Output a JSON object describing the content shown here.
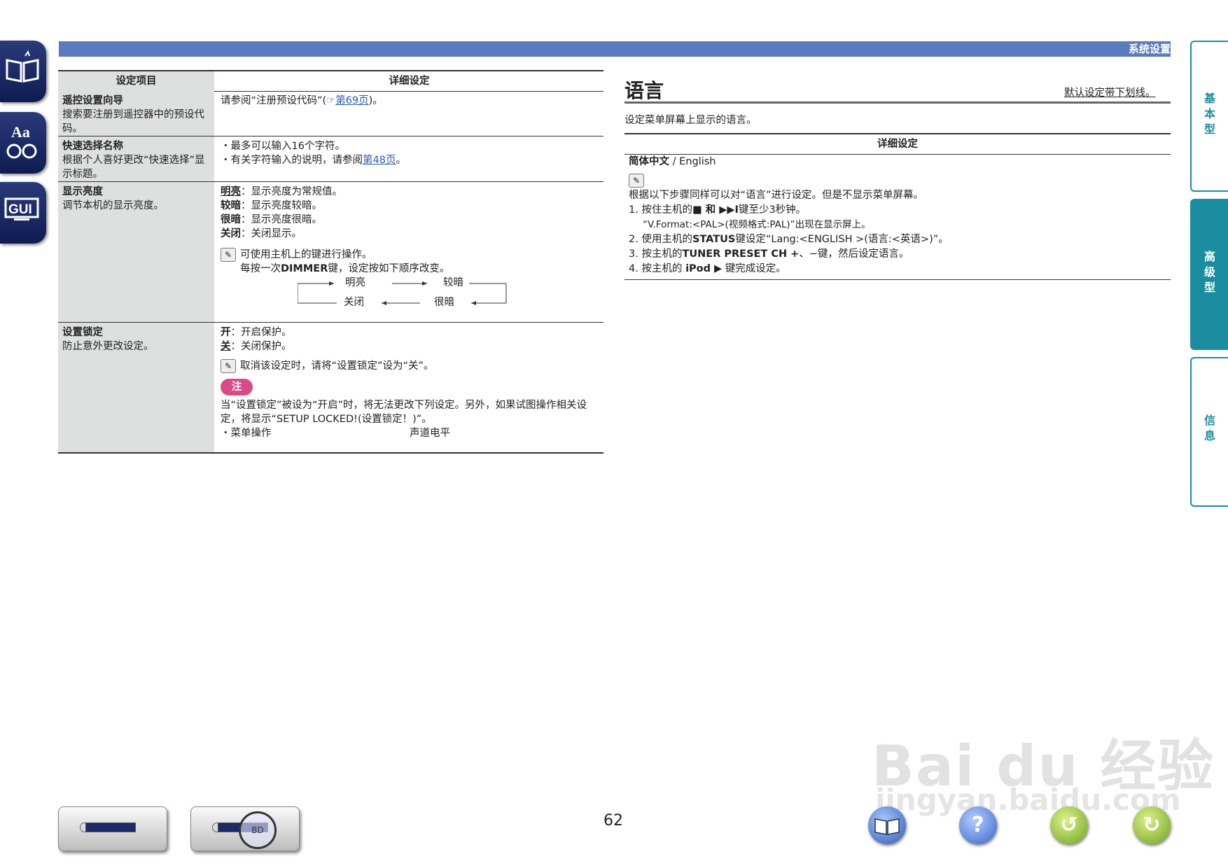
{
  "header": {
    "section_title": "系统设置"
  },
  "side_tabs": [
    {
      "label": "基本型",
      "active": false
    },
    {
      "label": "高级型",
      "active": true
    },
    {
      "label": "信息",
      "active": false
    }
  ],
  "left_icons": [
    "book-icon",
    "font-icon",
    "gui-icon"
  ],
  "left_table": {
    "col1_header": "设定项目",
    "col2_header": "详细设定",
    "rows": [
      {
        "item": "遥控设置向导",
        "desc": "搜索要注册到遥控器中的预设代码。",
        "detail_prefix": "请参阅“注册预设代码”(",
        "detail_link": "第69页",
        "detail_suffix": ")。"
      },
      {
        "item": "快速选择名称",
        "desc": "根据个人喜好更改“快速选择”显示标题。",
        "bullet1": "・最多可以输入16个字符。",
        "bullet2_prefix": "・有关字符输入的说明，请参阅",
        "bullet2_link": "第48页",
        "bullet2_suffix": "。"
      },
      {
        "item": "显示亮度",
        "desc": "调节本机的显示亮度。",
        "opts": [
          {
            "k": "明亮",
            "v": "显示亮度为常规值。"
          },
          {
            "k": "较暗",
            "v": "显示亮度较暗。"
          },
          {
            "k": "很暗",
            "v": "显示亮度很暗。"
          },
          {
            "k": "关闭",
            "v": "关闭显示。"
          }
        ],
        "note1": "可使用主机上的键进行操作。",
        "note2_prefix": "每按一次",
        "note2_key": "DIMMER",
        "note2_suffix": "键，设定按如下顺序改变。",
        "cycle": {
          "a": "明亮",
          "b": "较暗",
          "c": "很暗",
          "d": "关闭"
        }
      },
      {
        "item": "设置锁定",
        "desc": "防止意外更改设定。",
        "opt_on_k": "开",
        "opt_on_v": "开启保护。",
        "opt_off_k": "关",
        "opt_off_v": "关闭保护。",
        "note": "取消该设定时，请将“设置锁定”设为“关”。",
        "caution_label": "注",
        "caution_text": "当“设置锁定”被设为“开启”时，将无法更改下列设定。另外，如果试图操作相关设定，将显示“SETUP LOCKED!(设置锁定！)”。",
        "list_a": "・菜单操作",
        "list_b": "声道电平"
      }
    ]
  },
  "language_section": {
    "title": "语言",
    "default_note": "默认设定带下划线。",
    "description": "设定菜单屏幕上显示的语言。",
    "detail_header": "详细设定",
    "options_bold": "简体中文",
    "options_rest": " / English",
    "intro": "根据以下步骤同样可以对“语言”进行设定。但是不显示菜单屏幕。",
    "step1_prefix": "1. 按住主机的",
    "step1_keys": "■ 和 ▶▶I",
    "step1_suffix": "键至少3秒钟。",
    "step1_sub": "“V.Format:<PAL>(视频格式:PAL)”出现在显示屏上。",
    "step2_prefix": "2. 使用主机的",
    "step2_key": "STATUS",
    "step2_suffix": "键设定“Lang:<ENGLISH >(语言:<英语>)”。",
    "step3_prefix": "3. 按主机的",
    "step3_key": "TUNER PRESET CH +",
    "step3_suffix": "、−键，然后设定语言。",
    "step4_prefix": "4. 按主机的 ",
    "step4_key": "iPod ▶",
    "step4_suffix": " 键完成设定。"
  },
  "footer": {
    "page_number": "62",
    "device_label": "BD",
    "watermark": "Bai du 经验",
    "watermark_url": "jingyan.baidu.com"
  }
}
